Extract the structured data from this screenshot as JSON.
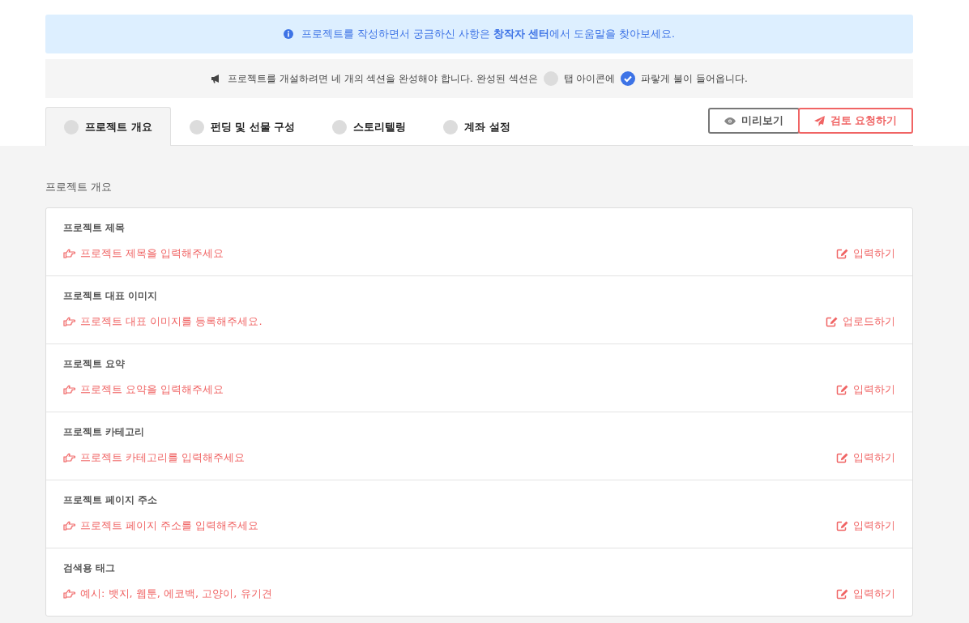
{
  "info_banner": {
    "text": "프로젝트를 작성하면서 궁금하신 사항은 **창작자 센터**에서 도움말을 찾아보세요."
  },
  "notice": {
    "before": "프로젝트를 개설하려면 네 개의 섹션을 완성해야 합니다. 완성된 섹션은",
    "middle": "탭 아이콘에",
    "after": "파랗게 불이 들어옵니다."
  },
  "tabs": [
    {
      "label": "프로젝트 개요",
      "selected": true,
      "completed": false
    },
    {
      "label": "펀딩 및 선물 구성",
      "selected": false,
      "completed": false
    },
    {
      "label": "스토리텔링",
      "selected": false,
      "completed": false
    },
    {
      "label": "계좌 설정",
      "selected": false,
      "completed": false
    }
  ],
  "buttons": {
    "preview": "미리보기",
    "review": "검토 요청하기"
  },
  "section_title": "프로젝트 개요",
  "fields": [
    {
      "label": "프로젝트 제목",
      "prompt": "프로젝트 제목을 입력해주세요",
      "action": "입력하기"
    },
    {
      "label": "프로젝트 대표 이미지",
      "prompt": "프로젝트 대표 이미지를 등록해주세요.",
      "action": "업로드하기"
    },
    {
      "label": "프로젝트 요약",
      "prompt": "프로젝트 요약을 입력해주세요",
      "action": "입력하기"
    },
    {
      "label": "프로젝트 카테고리",
      "prompt": "프로젝트 카테고리를 입력해주세요",
      "action": "입력하기"
    },
    {
      "label": "프로젝트 페이지 주소",
      "prompt": "프로젝트 페이지 주소를 입력해주세요",
      "action": "입력하기"
    },
    {
      "label": "검색용 태그",
      "prompt": "예시: 뱃지, 웹툰, 에코백, 고양이, 유기견",
      "action": "입력하기"
    }
  ]
}
